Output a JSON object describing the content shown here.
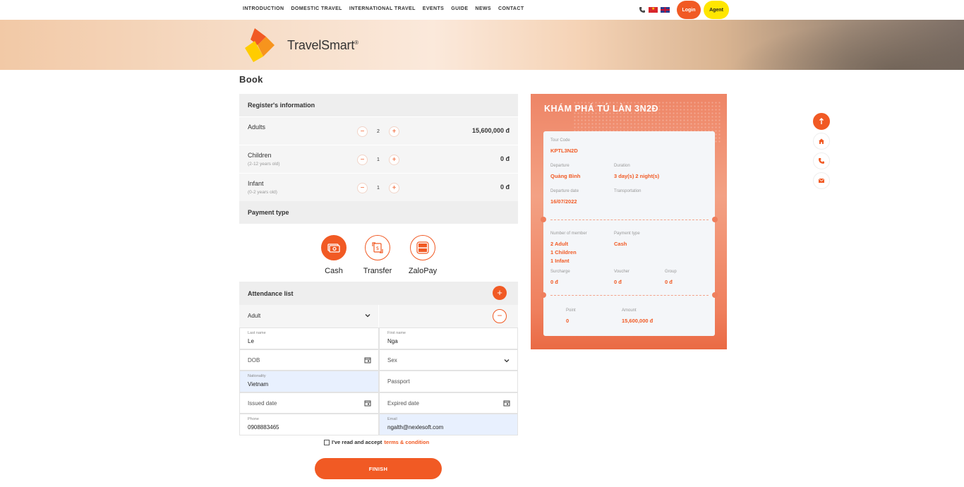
{
  "nav": {
    "items": [
      "INTRODUCTION",
      "DOMESTIC TRAVEL",
      "INTERNATIONAL TRAVEL",
      "EVENTS",
      "GUIDE",
      "NEWS",
      "CONTACT"
    ],
    "login_label": "Login",
    "agent_label": "Agent"
  },
  "brand": {
    "name": "TravelSmart",
    "reg": "®"
  },
  "page_title": "Book",
  "register": {
    "title": "Register's information",
    "rows": [
      {
        "label": "Adults",
        "sub": "",
        "count": "2",
        "price": "15,600,000 đ"
      },
      {
        "label": "Children",
        "sub": "(2-12 years old)",
        "count": "1",
        "price": "0 đ"
      },
      {
        "label": "Infant",
        "sub": "(0-2 years old)",
        "count": "1",
        "price": "0 đ"
      }
    ],
    "minus": "−",
    "plus": "+"
  },
  "payment": {
    "title": "Payment type",
    "options": [
      {
        "label": "Cash",
        "icon": "cash-icon",
        "selected": true
      },
      {
        "label": "Transfer",
        "icon": "transfer-icon",
        "selected": false
      },
      {
        "label": "ZaloPay",
        "icon": "zalopay-icon",
        "selected": false
      }
    ]
  },
  "attendance": {
    "title": "Attendance list",
    "add": "+",
    "remove": "−",
    "type_selected": "Adult",
    "fields": {
      "last_name_caption": "Last name",
      "last_name": "Le",
      "first_name_caption": "First name",
      "first_name": "Nga",
      "dob_placeholder": "DOB",
      "sex_placeholder": "Sex",
      "nationality_caption": "Nationality",
      "nationality": "Vietnam",
      "passport_placeholder": "Passport",
      "issued_placeholder": "Issued date",
      "expired_placeholder": "Expired date",
      "phone_caption": "Phone",
      "phone": "0908883465",
      "email_caption": "Email",
      "email": "ngalth@nexlesoft.com"
    }
  },
  "agree": {
    "text": "I've read and accept",
    "link": "terms & condition"
  },
  "finish_label": "FINISH",
  "ticket": {
    "title": "KHÁM PHÁ TÚ LÀN 3N2Đ",
    "tour_code_caption": "Tour Code",
    "tour_code": "KPTL3N2D",
    "departure_caption": "Departure",
    "departure": "Quảng Bình",
    "duration_caption": "Duration",
    "duration": "3 day(s) 2 night(s)",
    "departure_date_caption": "Departure date",
    "departure_date": "16/07/2022",
    "transportation_caption": "Transportation",
    "members_caption": "Number of member",
    "members": [
      "2 Adult",
      "1 Children",
      "1 Infant"
    ],
    "payment_caption": "Payment type",
    "payment": "Cash",
    "surcharge_caption": "Surcharge",
    "surcharge": "0 đ",
    "voucher_caption": "Voucher",
    "voucher": "0 đ",
    "group_caption": "Group",
    "group": "0 đ",
    "point_caption": "Point",
    "point": "0",
    "amount_caption": "Amount",
    "amount": "15,600,000 đ"
  },
  "colors": {
    "accent": "#f15a24",
    "agent": "#ffe600"
  }
}
